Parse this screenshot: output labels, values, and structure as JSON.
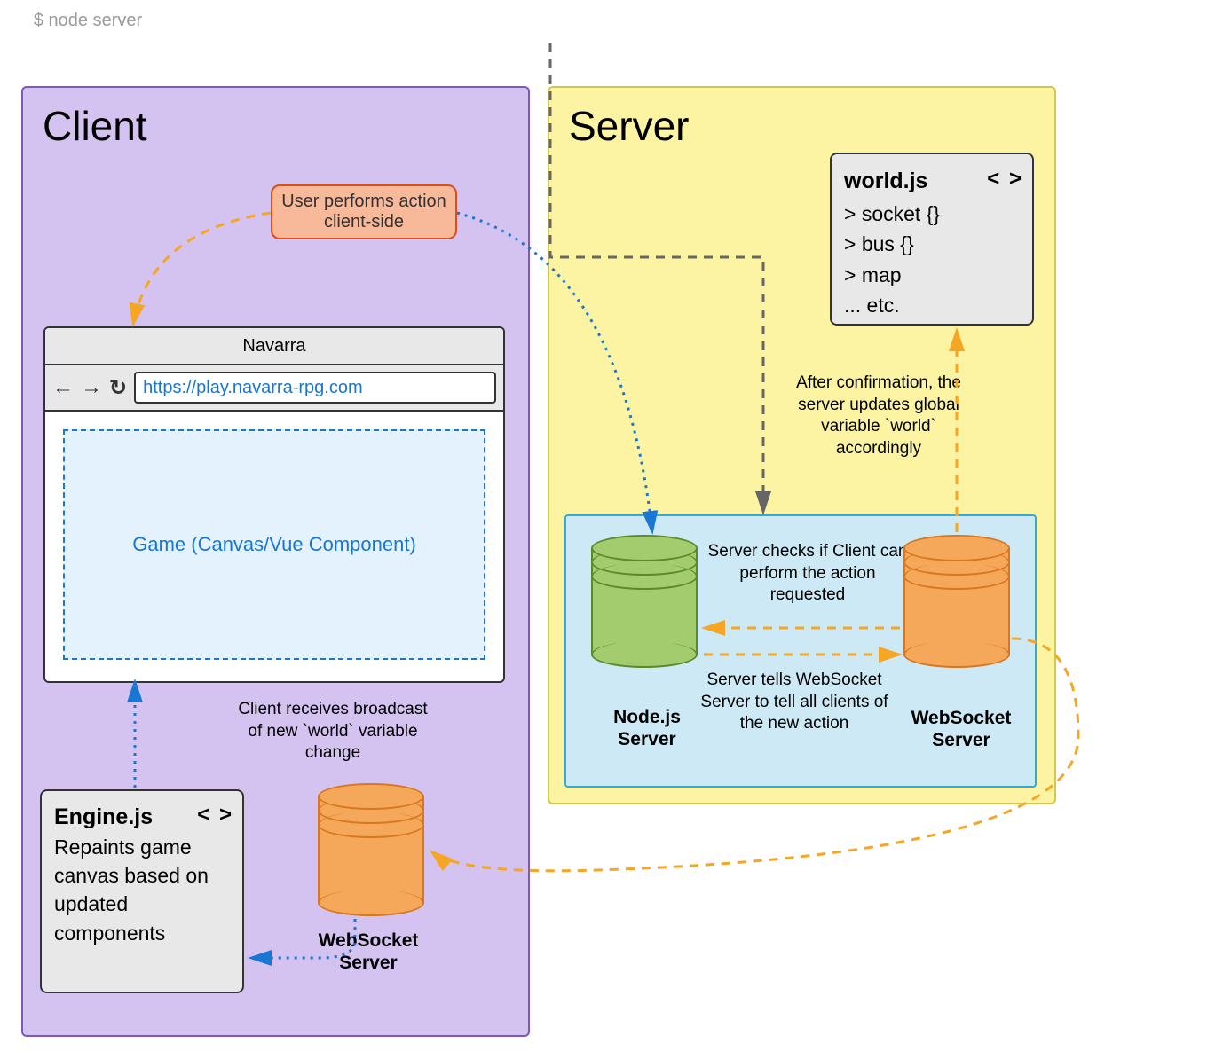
{
  "command": "$ node server",
  "client": {
    "title": "Client",
    "user_action": "User performs action client-side",
    "browser": {
      "title": "Navarra",
      "url": "https://play.navarra-rpg.com",
      "canvas_label": "Game (Canvas/Vue Component)"
    },
    "client_receives": "Client receives broadcast of new `world` variable change",
    "engine": {
      "title": "Engine.js",
      "body": "Repaints game canvas based on updated components",
      "code_icon": "< >"
    },
    "ws_label": "WebSocket Server"
  },
  "server": {
    "title": "Server",
    "world": {
      "title": "world.js",
      "code_icon": "< >",
      "lines": [
        "> socket {}",
        "> bus {}",
        "> map",
        "... etc."
      ]
    },
    "after_confirm": "After confirmation, the server updates global variable `world` accordingly",
    "server_checks": "Server checks if Client can perform the action requested",
    "server_tells": "Server tells WebSocket Server to tell all clients of the new action",
    "nodejs_label": "Node.js Server",
    "ws_label": "WebSocket Server"
  }
}
